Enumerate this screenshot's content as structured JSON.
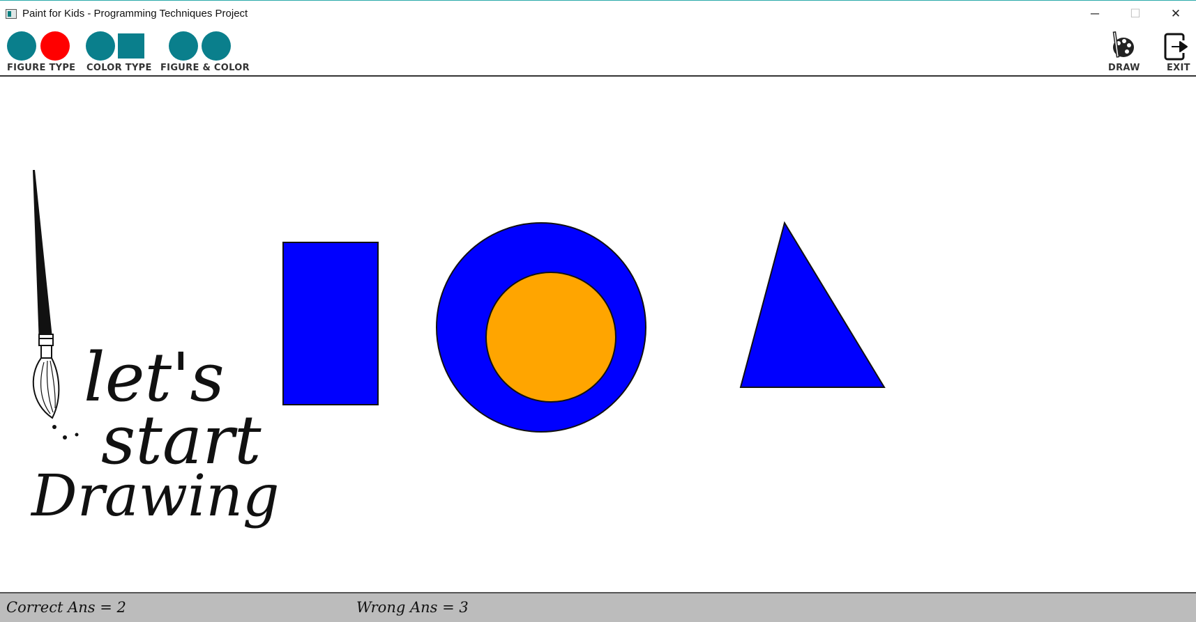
{
  "window": {
    "title": "Paint for Kids - Programming Techniques Project",
    "minimize_glyph": "─",
    "maximize_glyph": "☐",
    "close_glyph": "✕"
  },
  "toolbar": {
    "figure_type_label": "FIGURE TYPE",
    "color_type_label": "COLOR TYPE",
    "figure_color_label": "FIGURE & COLOR",
    "draw_label": "DRAW",
    "exit_label": "EXIT"
  },
  "colors": {
    "teal": "#0a7f8c",
    "red": "#ff0000",
    "blue": "#0000ff",
    "orange": "#ffa500",
    "status_bg": "#bcbcbc"
  },
  "icons": [
    "palette-icon",
    "exit-icon",
    "paintbrush-icon"
  ],
  "canvas": {
    "decoration_text": [
      "let's",
      "start",
      "Drawing"
    ],
    "shapes": [
      "rectangle",
      "outer-circle",
      "inner-circle",
      "triangle"
    ]
  },
  "status": {
    "correct": "Correct Ans = 2",
    "wrong": "Wrong Ans = 3"
  }
}
